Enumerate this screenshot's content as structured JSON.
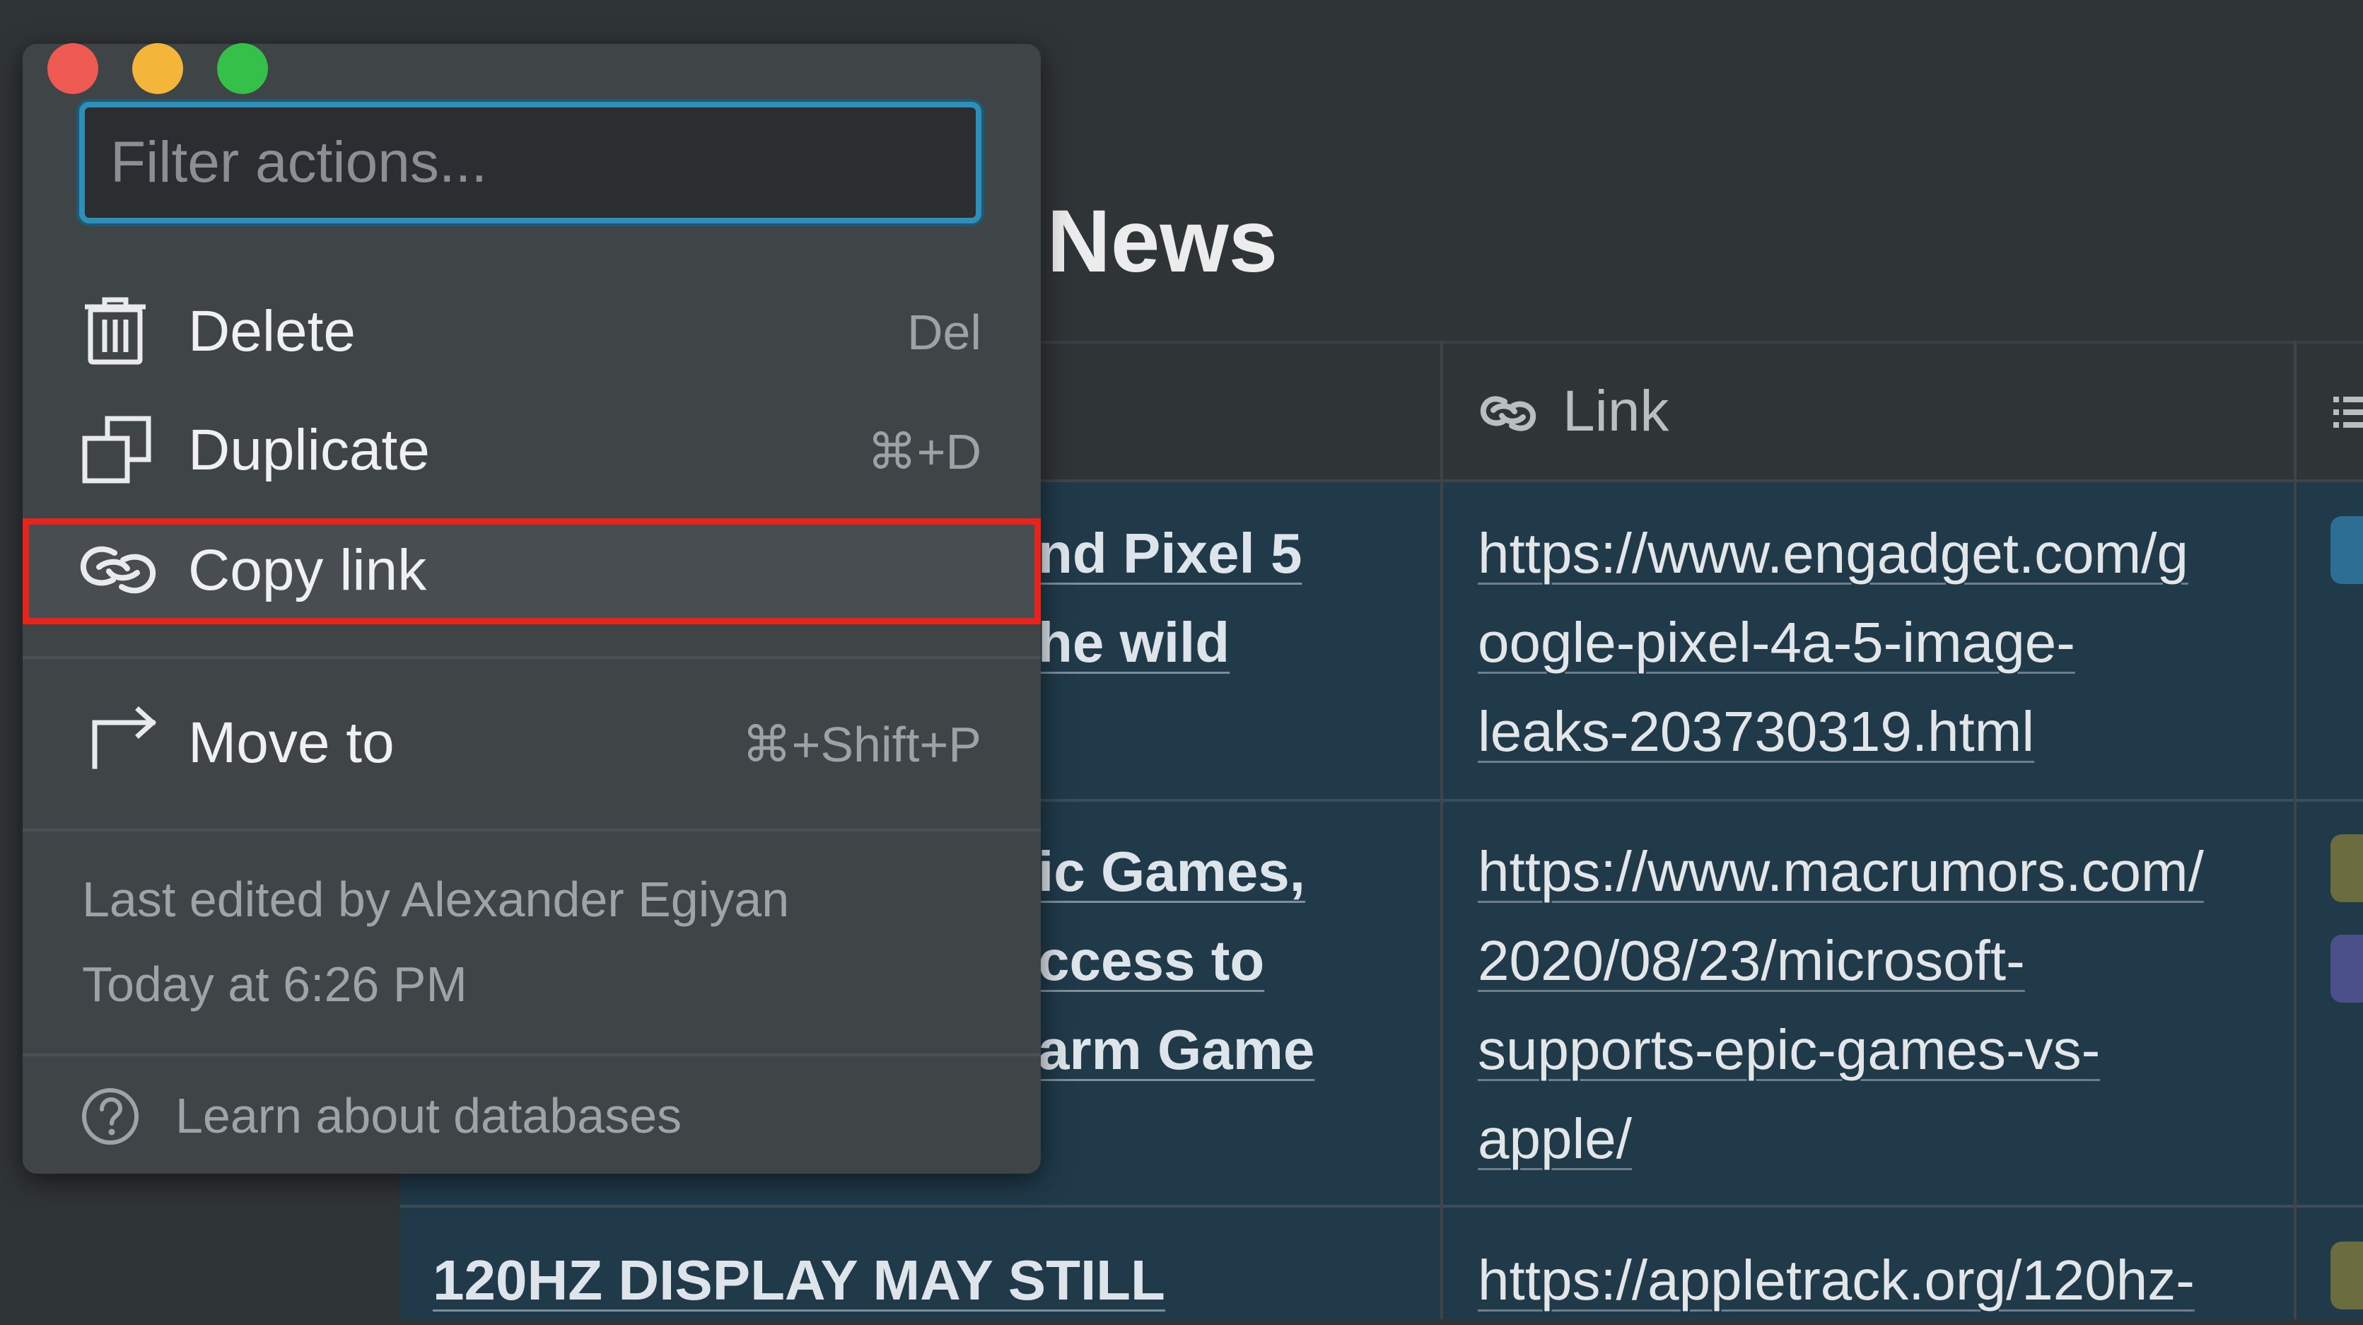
{
  "page": {
    "title": "ch News"
  },
  "table": {
    "header": {
      "link_column": "Link"
    },
    "rows": [
      {
        "name_lines": [
          "nd Pixel 5",
          "he wild"
        ],
        "link_lines": [
          "https://www.engadget.com/g",
          "oogle-pixel-4a-5-image-",
          "leaks-203730319.html"
        ]
      },
      {
        "name_lines": [
          "ic Games,",
          "ccess to",
          "arm Game"
        ],
        "link_lines": [
          "https://www.macrumors.com/",
          "2020/08/23/microsoft-",
          "supports-epic-games-vs-",
          "apple/"
        ]
      },
      {
        "name_lines": [
          "120HZ DISPLAY MAY STILL"
        ],
        "link_lines": [
          "https://appletrack.org/120hz-"
        ]
      }
    ]
  },
  "popup": {
    "filter_placeholder": "Filter actions...",
    "items": [
      {
        "label": "Delete",
        "shortcut": "Del"
      },
      {
        "label": "Duplicate",
        "shortcut": "⌘+D"
      },
      {
        "label": "Copy link",
        "shortcut": ""
      },
      {
        "label": "Move to",
        "shortcut": "⌘+Shift+P"
      }
    ],
    "last_edited_by": "Last edited by Alexander Egiyan",
    "last_edited_time": "Today at 6:26 PM",
    "help": "Learn about databases"
  },
  "icons": {
    "delete": "trash-icon",
    "duplicate": "duplicate-icon",
    "copy_link": "link-icon",
    "move_to": "move-arrow-icon",
    "help": "question-circle-icon"
  },
  "colors": {
    "highlight": "#e8231c",
    "filter_focus": "#2f8fb8",
    "close": "#ee5a52",
    "minimize": "#f3b53a",
    "maximize": "#34c049"
  }
}
